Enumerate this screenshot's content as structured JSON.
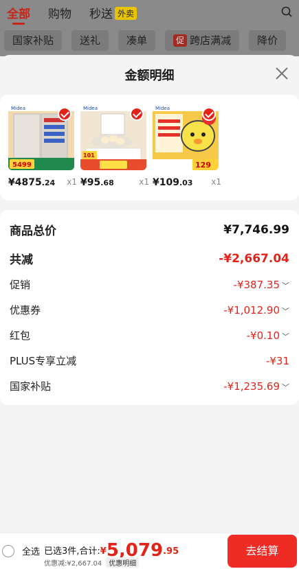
{
  "top_tabs": [
    {
      "label": "全部",
      "active": true
    },
    {
      "label": "购物",
      "active": false
    },
    {
      "label": "秒送",
      "active": false,
      "badge": "外卖"
    }
  ],
  "filter_chips": [
    "国家补贴",
    "送礼",
    "凑单",
    "跨店满减",
    "降价"
  ],
  "filter_chip_badge": "促",
  "sheet": {
    "title": "金额明细",
    "products": [
      {
        "price_int": "¥4875",
        "price_dec": ".24",
        "qty": "x1"
      },
      {
        "price_int": "¥95",
        "price_dec": ".68",
        "qty": "x1"
      },
      {
        "price_int": "¥109",
        "price_dec": ".03",
        "qty": "x1"
      }
    ],
    "breakdown": [
      {
        "label": "商品总价",
        "value": "¥7,746.99"
      },
      {
        "label": "共减",
        "value": "-¥2,667.04"
      },
      {
        "label": "促销",
        "value": "-¥387.35"
      },
      {
        "label": "优惠券",
        "value": "-¥1,012.90"
      },
      {
        "label": "红包",
        "value": "-¥0.10"
      },
      {
        "label": "PLUS专享立减",
        "value": "-¥31"
      },
      {
        "label": "国家补贴",
        "value": "-¥1,235.69"
      }
    ]
  },
  "bottom_bar": {
    "select_all": "全选",
    "selected_text": "已选3件,合计:",
    "currency": "¥",
    "total_int": "5,079",
    "total_dec": ".95",
    "savings_text": "优惠减:¥2,667.04",
    "detail_link": "优惠明细",
    "checkout": "去结算"
  },
  "colors": {
    "accent": "#e2231a",
    "checkout_bg": "#ee2b24"
  }
}
